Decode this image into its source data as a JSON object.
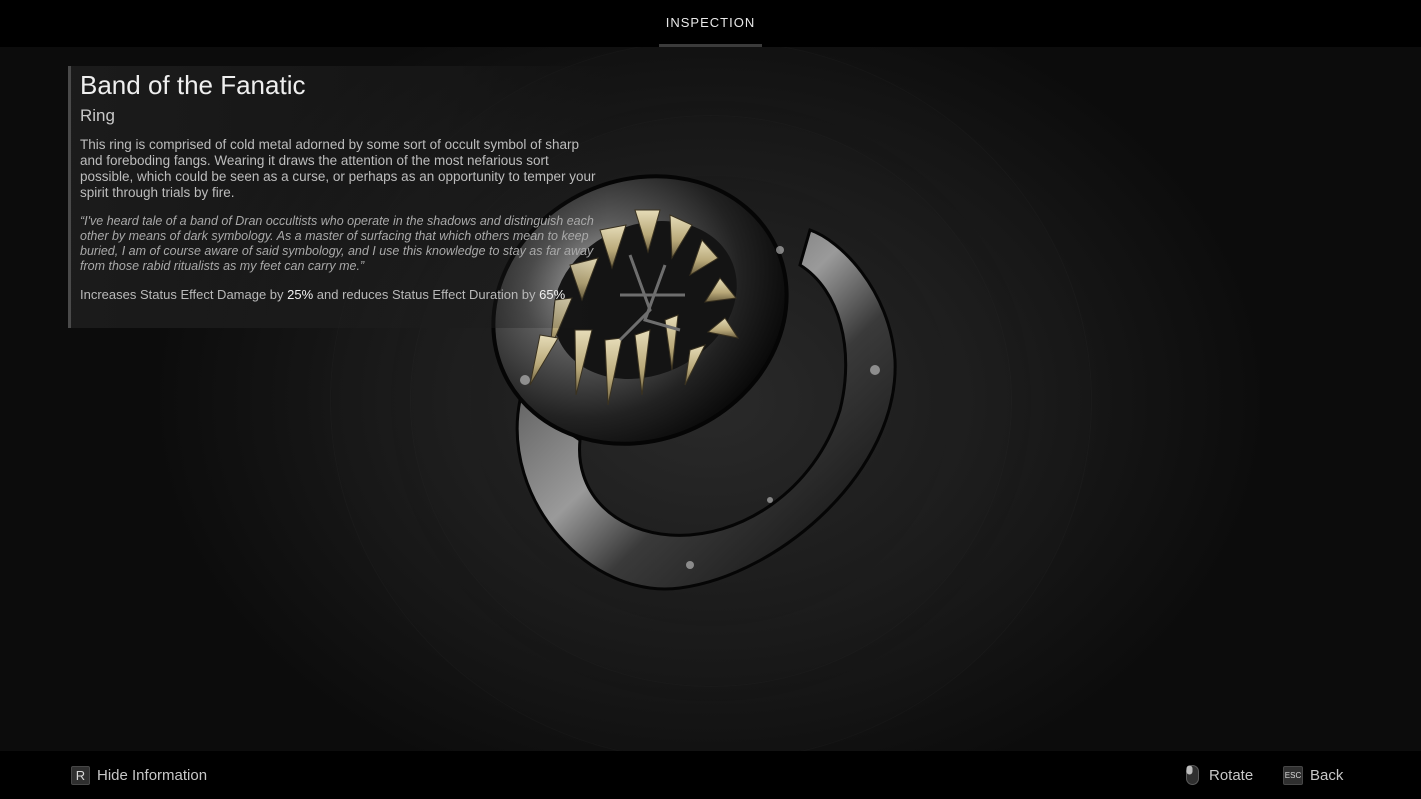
{
  "header": {
    "tab_label": "INSPECTION"
  },
  "item": {
    "name": "Band of the Fanatic",
    "type": "Ring",
    "description": "This ring is comprised of cold metal adorned by some sort of occult symbol of sharp and foreboding fangs. Wearing it draws the attention of the most nefarious sort possible, which could be seen as a curse, or perhaps as an opportunity to temper your spirit through trials by fire.",
    "lore": "“I've heard tale of a band of Dran occultists who operate in the shadows and distinguish each other by means of dark symbology. As a master of surfacing that which others mean to keep buried, I am of course aware of said symbology, and I use this knowledge to stay as far away from those rabid ritualists as my feet can carry me.”",
    "effect": {
      "prefix": "Increases Status Effect Damage by ",
      "damage_value": "25%",
      "middle": " and reduces Status Effect Duration by ",
      "duration_value": "65%"
    }
  },
  "footer": {
    "hide_info": {
      "key": "R",
      "label": "Hide Information"
    },
    "rotate": {
      "label": "Rotate",
      "icon": "mouse-icon"
    },
    "back": {
      "key": "ESC",
      "label": "Back"
    }
  },
  "colors": {
    "bar_background": "#000000",
    "scene_background": "#1d1d1d",
    "tooth": "#cdbf95",
    "metal": "#8a8a8a"
  }
}
